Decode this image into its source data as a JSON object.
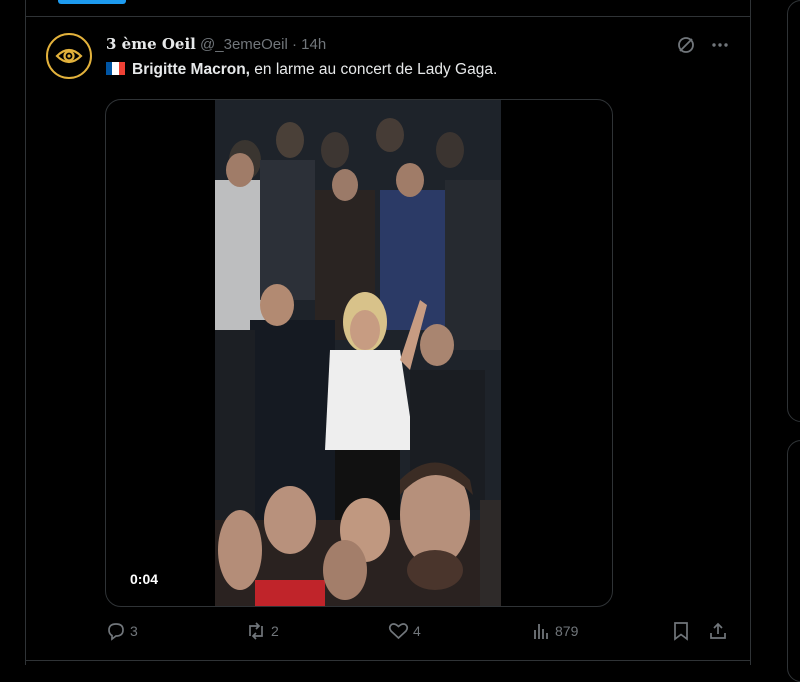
{
  "tweet": {
    "author_name": "3 ème Oeil",
    "author_handle": "@_3emeOeil",
    "separator": "·",
    "time": "14h",
    "text_bold": "Brigitte Macron,",
    "text_rest": " en larme au concert de Lady Gaga.",
    "video_time": "0:04"
  },
  "actions": {
    "replies": "3",
    "reposts": "2",
    "likes": "4",
    "views": "879"
  },
  "colors": {
    "background": "#000000",
    "border": "#2f3336",
    "muted": "#71767b",
    "accent": "#1d9bf0",
    "avatar_ring": "#e3b23c"
  },
  "icons": [
    "eye-icon",
    "grok-icon",
    "more-icon",
    "reply-icon",
    "repost-icon",
    "like-icon",
    "views-icon",
    "bookmark-icon",
    "share-icon"
  ]
}
